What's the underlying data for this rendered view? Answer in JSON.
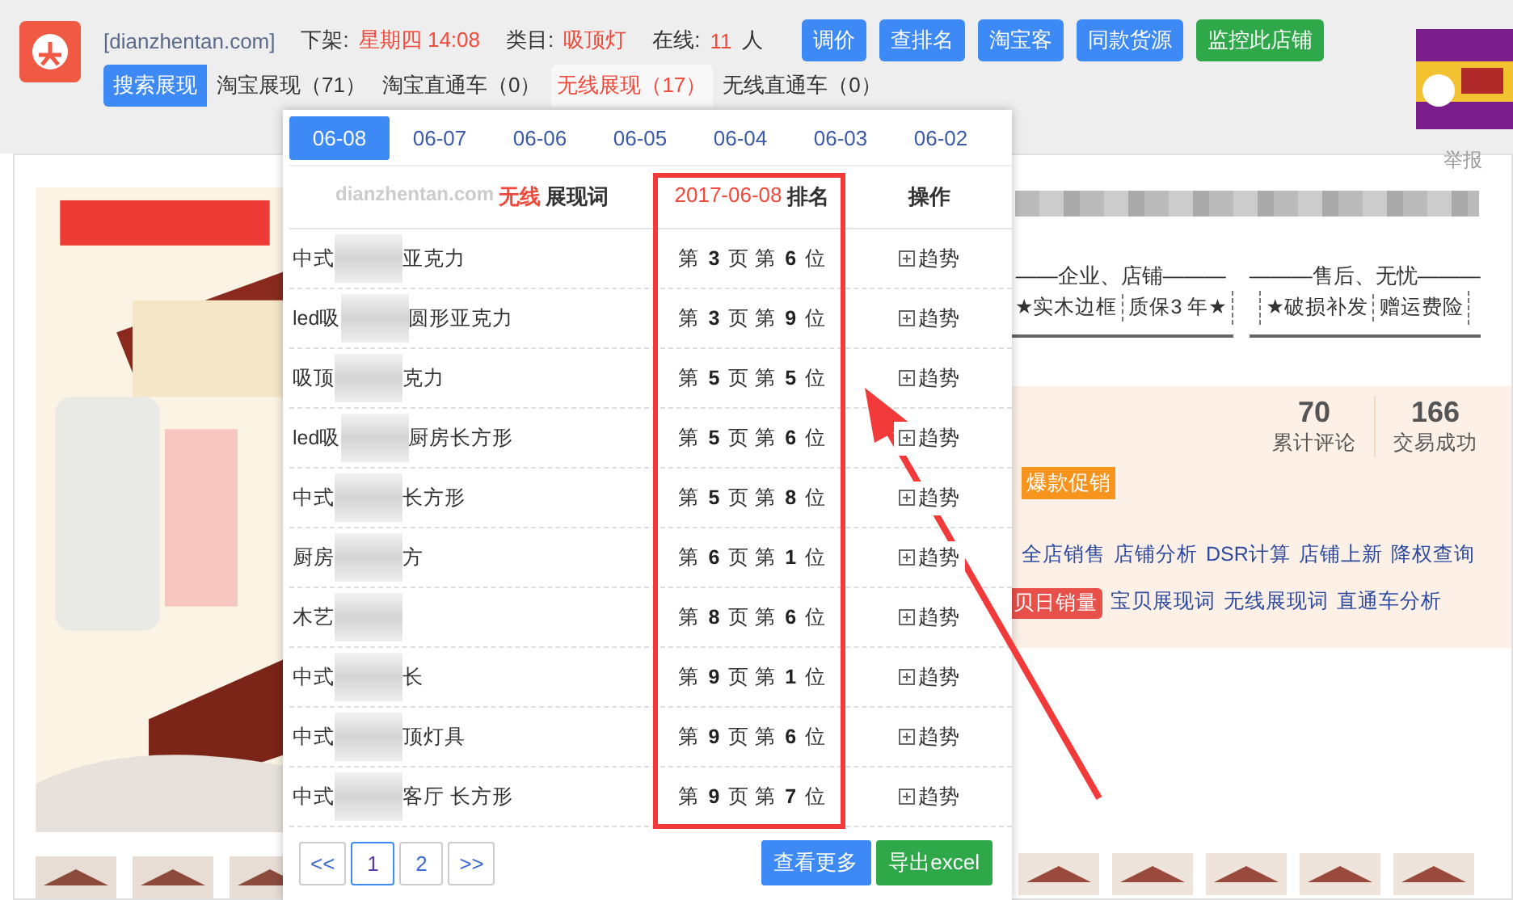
{
  "header": {
    "site": "[dianzhentan.com]",
    "fields": [
      {
        "label": "下架:",
        "value": "星期四 14:08"
      },
      {
        "label": "类目:",
        "value": "吸顶灯"
      },
      {
        "label": "在线:",
        "value": "11",
        "unit": "人"
      }
    ],
    "buttons": [
      {
        "label": "调价",
        "kind": "primary"
      },
      {
        "label": "查排名",
        "kind": "primary"
      },
      {
        "label": "淘宝客",
        "kind": "primary"
      },
      {
        "label": "同款货源",
        "kind": "primary"
      },
      {
        "label": "监控此店铺",
        "kind": "success"
      }
    ],
    "section_label": "搜索展现",
    "tabs": [
      {
        "label": "淘宝展现（71）",
        "selected": false
      },
      {
        "label": "淘宝直通车（0）",
        "selected": false
      },
      {
        "label": "无线展现（17）",
        "selected": true
      },
      {
        "label": "无线直通车（0）",
        "selected": false
      }
    ]
  },
  "popup": {
    "dates": [
      {
        "label": "06-08",
        "selected": true
      },
      {
        "label": "06-07",
        "selected": false
      },
      {
        "label": "06-06",
        "selected": false
      },
      {
        "label": "06-05",
        "selected": false
      },
      {
        "label": "06-04",
        "selected": false
      },
      {
        "label": "06-03",
        "selected": false
      },
      {
        "label": "06-02",
        "selected": false
      }
    ],
    "columns": {
      "site": "dianzhentan.com",
      "highlight": "无线",
      "keyword": "展现词",
      "date": "2017-06-08",
      "rank": "排名",
      "action": "操作"
    },
    "rows": [
      {
        "prefix": "中式",
        "suffix": "亚克力",
        "rank": "第 **3** 页 第 **6** 位",
        "action": "趋势"
      },
      {
        "prefix": "led吸",
        "suffix": "圆形亚克力",
        "rank": "第 **3** 页 第 **9** 位",
        "action": "趋势"
      },
      {
        "prefix": "吸顶",
        "suffix": "克力",
        "rank": "第 **5** 页 第 **5** 位",
        "action": "趋势"
      },
      {
        "prefix": "led吸",
        "suffix": "厨房长方形",
        "rank": "第 **5** 页 第 **6** 位",
        "action": "趋势"
      },
      {
        "prefix": "中式",
        "suffix": "长方形",
        "rank": "第 **5** 页 第 **8** 位",
        "action": "趋势"
      },
      {
        "prefix": "厨房",
        "suffix": "方",
        "rank": "第 **6** 页 第 **1** 位",
        "action": "趋势"
      },
      {
        "prefix": "木艺",
        "rank": "第 **8** 页 第 **6** 位",
        "action": "趋势"
      },
      {
        "prefix": "中式",
        "suffix": "长",
        "rank": "第 **9** 页 第 **1** 位",
        "action": "趋势"
      },
      {
        "prefix": "中式",
        "suffix": "顶灯具",
        "rank": "第 **9** 页 第 **6** 位",
        "action": "趋势"
      },
      {
        "prefix": "中式",
        "suffix": "客厅 长方形",
        "rank": "第 **9** 页 第 **7** 位",
        "action": "趋势"
      }
    ],
    "pages": [
      {
        "label": "<<",
        "selected": false
      },
      {
        "label": "1",
        "selected": true
      },
      {
        "label": "2",
        "selected": false
      },
      {
        "label": ">>",
        "selected": false
      }
    ],
    "more_button": "查看更多",
    "export_button": "导出excel"
  },
  "product": {
    "report": "举报",
    "guarantees": [
      {
        "title": "——企业、店铺———",
        "items": [
          "★实木边框",
          "质保3 年★"
        ]
      },
      {
        "title": "———售后、无忧———",
        "items": [
          "★破损补发",
          "赠运费险"
        ]
      }
    ],
    "stats": [
      {
        "value": "70",
        "label": "累计评论"
      },
      {
        "value": "166",
        "label": "交易成功"
      }
    ],
    "promo_badge": "爆款促销",
    "links_1": [
      "全店销售",
      "店铺分析",
      "DSR计算",
      "店铺上新",
      "降权查询"
    ],
    "highlight_link": "贝日销量",
    "links_2": [
      "宝贝展现词",
      "无线展现词",
      "直通车分析"
    ]
  }
}
